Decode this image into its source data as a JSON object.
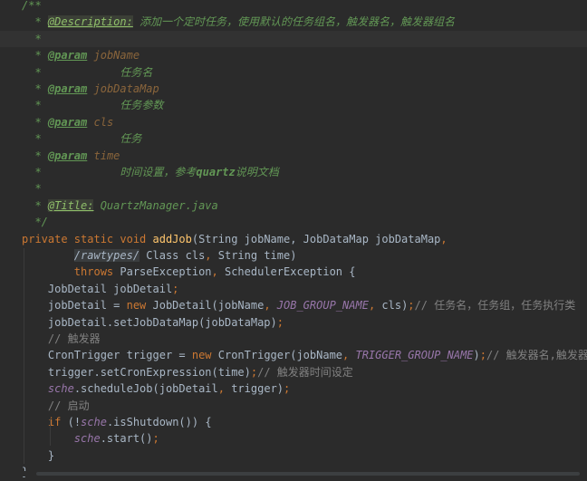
{
  "editor": {
    "lines": [
      {
        "segments": [
          {
            "t": "/**",
            "c": "c-doc"
          }
        ]
      },
      {
        "segments": [
          {
            "t": "  * ",
            "c": "c-doc"
          },
          {
            "t": "@Description:",
            "c": "c-tagbg"
          },
          {
            "t": " 添加一个定时任务，使用默认的任务组名，触发器名，触发器组名",
            "c": "c-cjkdoc"
          }
        ]
      },
      {
        "segments": [
          {
            "t": "  *",
            "c": "c-doc"
          }
        ],
        "hl": true
      },
      {
        "segments": [
          {
            "t": "  * ",
            "c": "c-doc"
          },
          {
            "t": "@param",
            "c": "c-tag"
          },
          {
            "t": " jobName",
            "c": "c-param"
          }
        ]
      },
      {
        "segments": [
          {
            "t": "  *            ",
            "c": "c-doc"
          },
          {
            "t": "任务名",
            "c": "c-cjkdoc"
          }
        ]
      },
      {
        "segments": [
          {
            "t": "  * ",
            "c": "c-doc"
          },
          {
            "t": "@param",
            "c": "c-tag"
          },
          {
            "t": " jobDataMap",
            "c": "c-param"
          }
        ]
      },
      {
        "segments": [
          {
            "t": "  *            ",
            "c": "c-doc"
          },
          {
            "t": "任务参数",
            "c": "c-cjkdoc"
          }
        ]
      },
      {
        "segments": [
          {
            "t": "  * ",
            "c": "c-doc"
          },
          {
            "t": "@param",
            "c": "c-tag"
          },
          {
            "t": " cls",
            "c": "c-param"
          }
        ]
      },
      {
        "segments": [
          {
            "t": "  *            ",
            "c": "c-doc"
          },
          {
            "t": "任务",
            "c": "c-cjkdoc"
          }
        ]
      },
      {
        "segments": [
          {
            "t": "  * ",
            "c": "c-doc"
          },
          {
            "t": "@param",
            "c": "c-tag"
          },
          {
            "t": " time",
            "c": "c-param"
          }
        ]
      },
      {
        "segments": [
          {
            "t": "  *            ",
            "c": "c-doc"
          },
          {
            "t": "时间设置，参考",
            "c": "c-cjkdoc"
          },
          {
            "t": "quartz",
            "c": "c-doc bold"
          },
          {
            "t": "说明文档",
            "c": "c-cjkdoc"
          }
        ]
      },
      {
        "segments": [
          {
            "t": "  *",
            "c": "c-doc"
          }
        ]
      },
      {
        "segments": [
          {
            "t": "  * ",
            "c": "c-doc"
          },
          {
            "t": "@Title:",
            "c": "c-tagbg"
          },
          {
            "t": " QuartzManager.java",
            "c": "c-doc"
          }
        ]
      },
      {
        "segments": [
          {
            "t": "  */",
            "c": "c-doc"
          }
        ]
      },
      {
        "segments": [
          {
            "t": "private static void ",
            "c": "c-kw"
          },
          {
            "t": "addJob",
            "c": "c-fn"
          },
          {
            "t": "(String jobName, JobDataMap jobDataMap",
            "c": "c-plain"
          },
          {
            "t": ",",
            "c": "c-kw"
          }
        ]
      },
      {
        "segments": [
          {
            "t": "        ",
            "c": "c-plain"
          },
          {
            "t": "/rawtypes/",
            "c": "c-noinspect"
          },
          {
            "t": " Class cls",
            "c": "c-plain"
          },
          {
            "t": ", ",
            "c": "c-kw"
          },
          {
            "t": "String time)",
            "c": "c-plain"
          }
        ]
      },
      {
        "segments": [
          {
            "t": "        ",
            "c": "c-plain"
          },
          {
            "t": "throws ",
            "c": "c-kw"
          },
          {
            "t": "ParseException",
            "c": "c-plain"
          },
          {
            "t": ", ",
            "c": "c-kw"
          },
          {
            "t": "SchedulerException {",
            "c": "c-plain"
          }
        ]
      },
      {
        "segments": [
          {
            "t": "    JobDetail jobDetail",
            "c": "c-plain"
          },
          {
            "t": ";",
            "c": "c-kw"
          }
        ]
      },
      {
        "segments": [
          {
            "t": "    jobDetail = ",
            "c": "c-plain"
          },
          {
            "t": "new ",
            "c": "c-kw"
          },
          {
            "t": "JobDetail(jobName",
            "c": "c-plain"
          },
          {
            "t": ", ",
            "c": "c-kw"
          },
          {
            "t": "JOB_GROUP_NAME",
            "c": "c-const"
          },
          {
            "t": ", ",
            "c": "c-kw"
          },
          {
            "t": "cls)",
            "c": "c-plain"
          },
          {
            "t": ";",
            "c": "c-kw"
          },
          {
            "t": "// 任务名，任务组，任务执行类",
            "c": "c-cmt"
          }
        ]
      },
      {
        "segments": [
          {
            "t": "    jobDetail.setJobDataMap(jobDataMap)",
            "c": "c-plain"
          },
          {
            "t": ";",
            "c": "c-kw"
          }
        ]
      },
      {
        "segments": [
          {
            "t": "    // 触发器",
            "c": "c-cmt"
          }
        ]
      },
      {
        "segments": [
          {
            "t": "    CronTrigger trigger = ",
            "c": "c-plain"
          },
          {
            "t": "new ",
            "c": "c-kw"
          },
          {
            "t": "CronTrigger(jobName",
            "c": "c-plain"
          },
          {
            "t": ", ",
            "c": "c-kw"
          },
          {
            "t": "TRIGGER_GROUP_NAME",
            "c": "c-const"
          },
          {
            "t": ")",
            "c": "c-plain"
          },
          {
            "t": ";",
            "c": "c-kw"
          },
          {
            "t": "// 触发器名,触发器组",
            "c": "c-cmt"
          }
        ]
      },
      {
        "segments": [
          {
            "t": "    trigger.setCronExpression(time)",
            "c": "c-plain"
          },
          {
            "t": ";",
            "c": "c-kw"
          },
          {
            "t": "// 触发器时间设定",
            "c": "c-cmt"
          }
        ]
      },
      {
        "segments": [
          {
            "t": "    ",
            "c": "c-plain"
          },
          {
            "t": "sche",
            "c": "c-static"
          },
          {
            "t": ".scheduleJob(jobDetail",
            "c": "c-plain"
          },
          {
            "t": ", ",
            "c": "c-kw"
          },
          {
            "t": "trigger)",
            "c": "c-plain"
          },
          {
            "t": ";",
            "c": "c-kw"
          }
        ]
      },
      {
        "segments": [
          {
            "t": "    // 启动",
            "c": "c-cmt"
          }
        ]
      },
      {
        "segments": [
          {
            "t": "    ",
            "c": "c-plain"
          },
          {
            "t": "if ",
            "c": "c-kw"
          },
          {
            "t": "(!",
            "c": "c-plain"
          },
          {
            "t": "sche",
            "c": "c-static"
          },
          {
            "t": ".isShutdown()) {",
            "c": "c-plain"
          }
        ]
      },
      {
        "segments": [
          {
            "t": "        ",
            "c": "c-plain"
          },
          {
            "t": "sche",
            "c": "c-static"
          },
          {
            "t": ".start()",
            "c": "c-plain"
          },
          {
            "t": ";",
            "c": "c-kw"
          }
        ]
      },
      {
        "segments": [
          {
            "t": "    }",
            "c": "c-plain"
          }
        ]
      },
      {
        "segments": [
          {
            "t": "}",
            "c": "c-plain"
          }
        ]
      }
    ]
  }
}
